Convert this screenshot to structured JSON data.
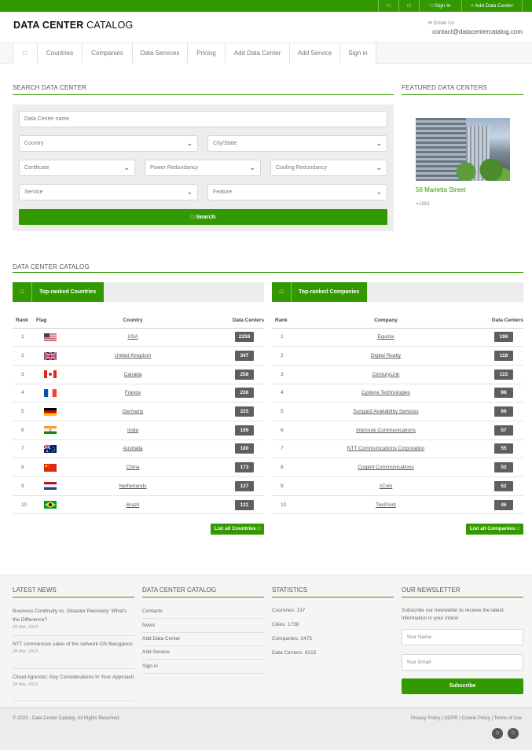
{
  "topbar": {
    "icon1": "□",
    "icon2": "□",
    "sign_in": "□ Sign In",
    "add_dc": "+ Add Data Center"
  },
  "header": {
    "logo_bold": "DATA CENTER",
    "logo_light": " CATALOG",
    "email_label": "✉ Email Us",
    "email": "contact@datacentercatalog.com"
  },
  "nav": {
    "home_icon": "□",
    "items": [
      "Countries",
      "Companies",
      "Data Services",
      "Pricing",
      "Add Data Center",
      "Add Service",
      "Sign in"
    ]
  },
  "search": {
    "title": "SEARCH DATA CENTER",
    "name_placeholder": "Data Center name",
    "country": "Country",
    "city": "City/State",
    "certificate": "Certificate",
    "power": "Power Redundancy",
    "cooling": "Cooling Redundancy",
    "service": "Service",
    "feature": "Feature",
    "button": "□ Search"
  },
  "featured": {
    "title": "FEATURED DATA CENTERS",
    "name": "56 Marietta Street",
    "country": "⌖ USA"
  },
  "catalog": {
    "title": "DATA CENTER CATALOG",
    "countries_tab": "Top-ranked Countries",
    "companies_tab": "Top-ranked Companies",
    "tab_icon": "□",
    "countries_headers": [
      "Rank",
      "Flag",
      "Country",
      "Data Centers"
    ],
    "companies_headers": [
      "Rank",
      "Company",
      "Data Centers"
    ],
    "countries": [
      {
        "rank": "1",
        "flag": "us",
        "name": "USA",
        "count": "2259"
      },
      {
        "rank": "2",
        "flag": "uk",
        "name": "United Kingdom",
        "count": "347"
      },
      {
        "rank": "3",
        "flag": "ca",
        "name": "Canada",
        "count": "256"
      },
      {
        "rank": "4",
        "flag": "fr",
        "name": "France",
        "count": "236"
      },
      {
        "rank": "5",
        "flag": "de",
        "name": "Germany",
        "count": "225"
      },
      {
        "rank": "6",
        "flag": "in",
        "name": "India",
        "count": "199"
      },
      {
        "rank": "7",
        "flag": "au",
        "name": "Australia",
        "count": "180"
      },
      {
        "rank": "8",
        "flag": "cn",
        "name": "China",
        "count": "173"
      },
      {
        "rank": "9",
        "flag": "nl",
        "name": "Netherlands",
        "count": "127"
      },
      {
        "rank": "10",
        "flag": "br",
        "name": "Brazil",
        "count": "121"
      }
    ],
    "companies": [
      {
        "rank": "1",
        "name": "Equinix",
        "count": "196"
      },
      {
        "rank": "2",
        "name": "Digital Realty",
        "count": "118"
      },
      {
        "rank": "3",
        "name": "CenturyLink",
        "count": "115"
      },
      {
        "rank": "4",
        "name": "Cyxtera Technologies",
        "count": "98"
      },
      {
        "rank": "5",
        "name": "Sungard Availability Services",
        "count": "66"
      },
      {
        "rank": "6",
        "name": "Interoute Communications",
        "count": "57"
      },
      {
        "rank": "7",
        "name": "NTT Communications Corporation",
        "count": "55"
      },
      {
        "rank": "8",
        "name": "Cogent Communications",
        "count": "52"
      },
      {
        "rank": "9",
        "name": "zColo",
        "count": "52"
      },
      {
        "rank": "10",
        "name": "TierPoint",
        "count": "46"
      }
    ],
    "list_countries": "List all Countries □",
    "list_companies": "List all Companies □"
  },
  "footer": {
    "news_title": "LATEST NEWS",
    "news": [
      {
        "title": "Business Continuity vs. Disaster Recovery: What's the Difference?",
        "date": "29 Mar, 2023"
      },
      {
        "title": "NTT commences sales of the network OS Beluganos",
        "date": "28 Mar, 2023"
      },
      {
        "title": "Cloud Agnostic: Key Considerations In Your Approach",
        "date": "24 Mar, 2023"
      }
    ],
    "catalog_title": "DATA CENTER CATALOG",
    "catalog_links": [
      "Contacts",
      "News",
      "Add Data Center",
      "Add Service",
      "Sign in"
    ],
    "stats_title": "STATISTICS",
    "stats": [
      "Countries: 137",
      "Cities: 1738",
      "Companies: 2475",
      "Data Centers: 6215"
    ],
    "newsletter_title": "OUR NEWSLETTER",
    "newsletter_desc": "Subscribe our newsletter to receive the latest information in your inbox!",
    "name_placeholder": "Your Name",
    "email_placeholder": "Your Email",
    "subscribe": "Subscribe"
  },
  "bottom": {
    "copy_prefix": "© 2023 - ",
    "copy_link": "Data Center Catalog",
    "copy_suffix": ". All Rights Reserved.",
    "privacy": "Privacy Policy",
    "gdpr": "GDPR",
    "cookie": "Cookie Policy",
    "terms": "Terms of Use",
    "sep": " | ",
    "social1": "□",
    "social2": "□"
  },
  "colors": {
    "accent": "#339900",
    "badge": "#5f5f5f"
  }
}
